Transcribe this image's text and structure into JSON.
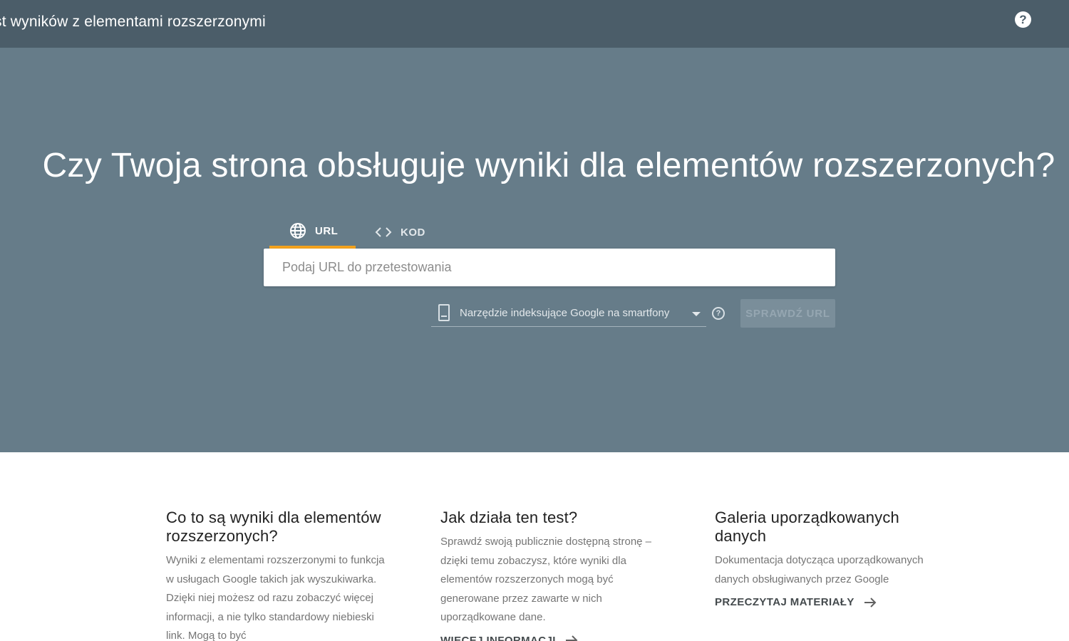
{
  "header": {
    "title": "st wyników z elementami rozszerzonymi",
    "help_label": "?"
  },
  "hero": {
    "title": "Czy Twoja strona obsługuje wyniki dla elementów rozszerzonych?",
    "tabs": [
      {
        "label": "URL",
        "icon": "globe-icon",
        "active": true
      },
      {
        "label": "KOD",
        "icon": "code-icon",
        "active": false
      }
    ],
    "url_input": {
      "placeholder": "Podaj URL do przetestowania",
      "value": ""
    },
    "crawler": {
      "selected": "Narzędzie indeksujące Google na smartfony",
      "icon": "smartphone-icon"
    },
    "info_label": "?",
    "check_button": "SPRAWDŹ URL"
  },
  "info_columns": [
    {
      "title": "Co to są wyniki dla elementów rozszerzonych?",
      "text": "Wyniki z elementami rozszerzonymi to funkcja w usługach Google takich jak wyszukiwarka. Dzięki niej możesz od razu zobaczyć więcej informacji, a nie tylko standardowy niebieski link. Mogą to być"
    },
    {
      "title": "Jak działa ten test?",
      "text": "Sprawdź swoją publicznie dostępną stronę – dzięki temu zobaczysz, które wyniki dla elementów rozszerzonych mogą być generowane przez zawarte w nich uporządkowane dane.",
      "link": "WIĘCEJ INFORMACJI"
    },
    {
      "title": "Galeria uporządkowanych danych",
      "text": "Dokumentacja dotycząca uporządkowanych danych obsługiwanych przez Google",
      "link": "PRZECZYTAJ MATERIAŁY"
    }
  ],
  "colors": {
    "topbar": "#4b5d69",
    "hero": "#667c89",
    "tab_accent": "#f4a21d"
  }
}
